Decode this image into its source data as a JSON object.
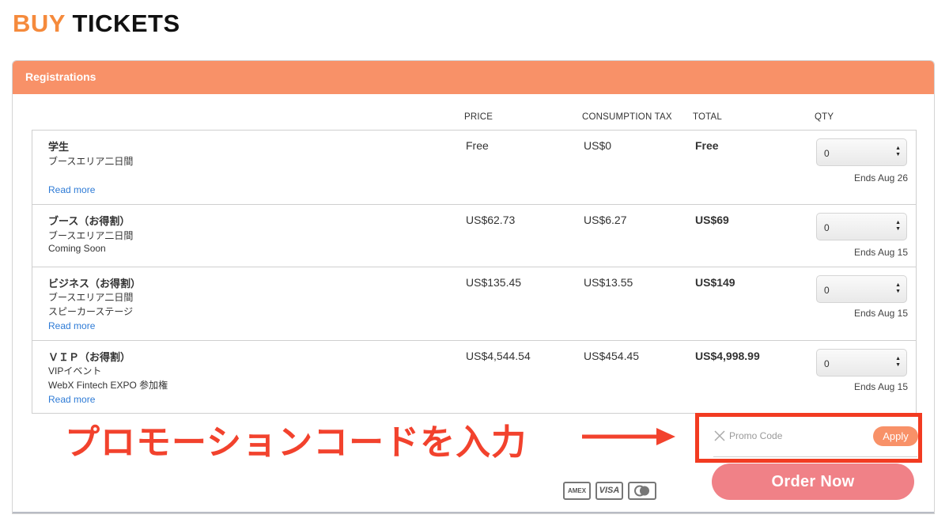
{
  "page": {
    "title_accent": "BUY",
    "title_rest": "TICKETS"
  },
  "panel": {
    "header": "Registrations",
    "columns": {
      "price": "PRICE",
      "tax": "CONSUMPTION TAX",
      "total": "TOTAL",
      "qty": "QTY"
    }
  },
  "tickets": [
    {
      "name": "学生",
      "desc": [
        "ブースエリア二日間"
      ],
      "read_more": "Read more",
      "price": "Free",
      "tax": "US$0",
      "total": "Free",
      "qty": "0",
      "ends": "Ends Aug 26"
    },
    {
      "name": "ブース（お得割）",
      "desc": [
        "ブースエリア二日間",
        "Coming Soon"
      ],
      "read_more": "",
      "price": "US$62.73",
      "tax": "US$6.27",
      "total": "US$69",
      "qty": "0",
      "ends": "Ends Aug 15"
    },
    {
      "name": "ビジネス（お得割）",
      "desc": [
        "ブースエリア二日間",
        "スピーカーステージ"
      ],
      "read_more": "Read more",
      "price": "US$135.45",
      "tax": "US$13.55",
      "total": "US$149",
      "qty": "0",
      "ends": "Ends Aug 15"
    },
    {
      "name": "ＶＩＰ（お得割）",
      "desc": [
        "VIPイベント",
        "WebX Fintech EXPO 参加権"
      ],
      "read_more": "Read more",
      "price": "US$4,544.54",
      "tax": "US$454.45",
      "total": "US$4,998.99",
      "qty": "0",
      "ends": "Ends Aug 15"
    }
  ],
  "annotation": {
    "text": "プロモーションコードを入力",
    "color": "#f2422d"
  },
  "promo": {
    "placeholder": "Promo Code",
    "apply_label": "Apply",
    "clear_icon": "close-icon"
  },
  "payment_methods": [
    "AMEX",
    "VISA",
    "mastercard-icon"
  ],
  "order_button": "Order Now",
  "colors": {
    "accent": "#f58a3c",
    "header": "#f89168",
    "order_button": "#f08187",
    "link": "#2e7bd6"
  }
}
